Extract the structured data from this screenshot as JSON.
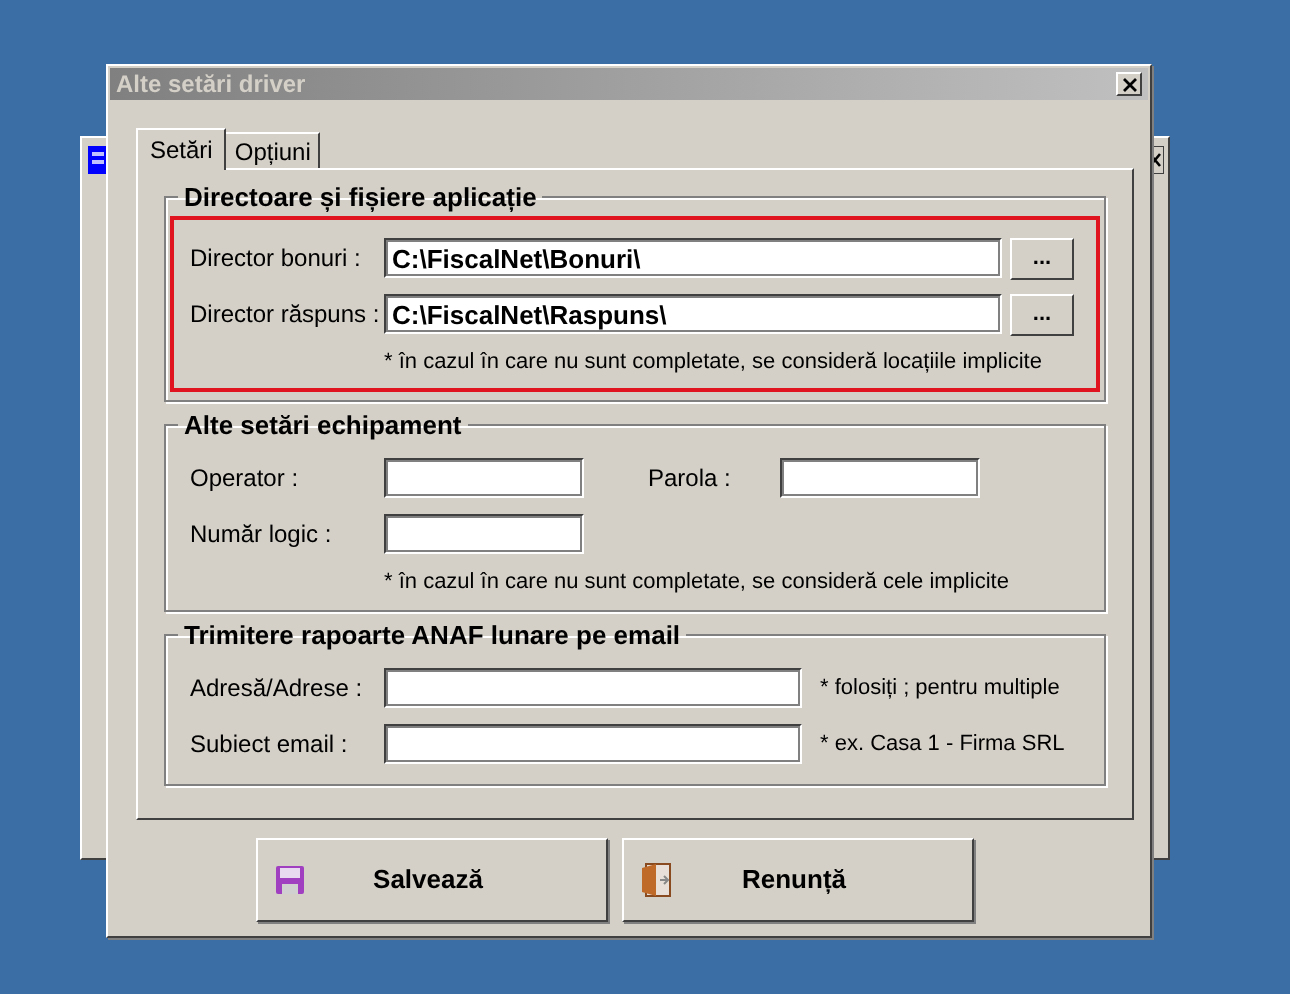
{
  "window": {
    "title": "Alte setări driver"
  },
  "tabs": [
    {
      "label": "Setări",
      "selected": true
    },
    {
      "label": "Opțiuni",
      "selected": false
    }
  ],
  "groups": [
    {
      "title": "Directoare și fișiere aplicație",
      "highlighted": true,
      "rows": [
        [
          {
            "label": "Director bonuri :",
            "value": "C:\\FiscalNet\\Bonuri\\",
            "browse": "..."
          }
        ],
        [
          {
            "label": "Director răspuns :",
            "value": "C:\\FiscalNet\\Raspuns\\",
            "browse": "..."
          }
        ]
      ],
      "note": "* în cazul în care nu sunt completate, se consideră locațiile implicite"
    },
    {
      "title": "Alte setări echipament",
      "highlighted": false,
      "rows": [
        [
          {
            "label": "Operator :"
          },
          {
            "label": "Parola :"
          }
        ],
        [
          {
            "label": "Număr logic :"
          }
        ]
      ],
      "note": "* în cazul în care nu sunt completate, se consideră cele implicite"
    },
    {
      "title": "Trimitere rapoarte ANAF lunare pe email",
      "highlighted": false,
      "rows": [
        [
          {
            "label": "Adresă/Adrese :",
            "hint": "* folosiți ; pentru multiple"
          }
        ],
        [
          {
            "label": "Subiect email :",
            "hint": "* ex. Casa 1 - Firma SRL"
          }
        ]
      ]
    }
  ],
  "buttons": [
    {
      "label": "Salvează",
      "kind": "save"
    },
    {
      "label": "Renunță",
      "kind": "cancel"
    }
  ]
}
